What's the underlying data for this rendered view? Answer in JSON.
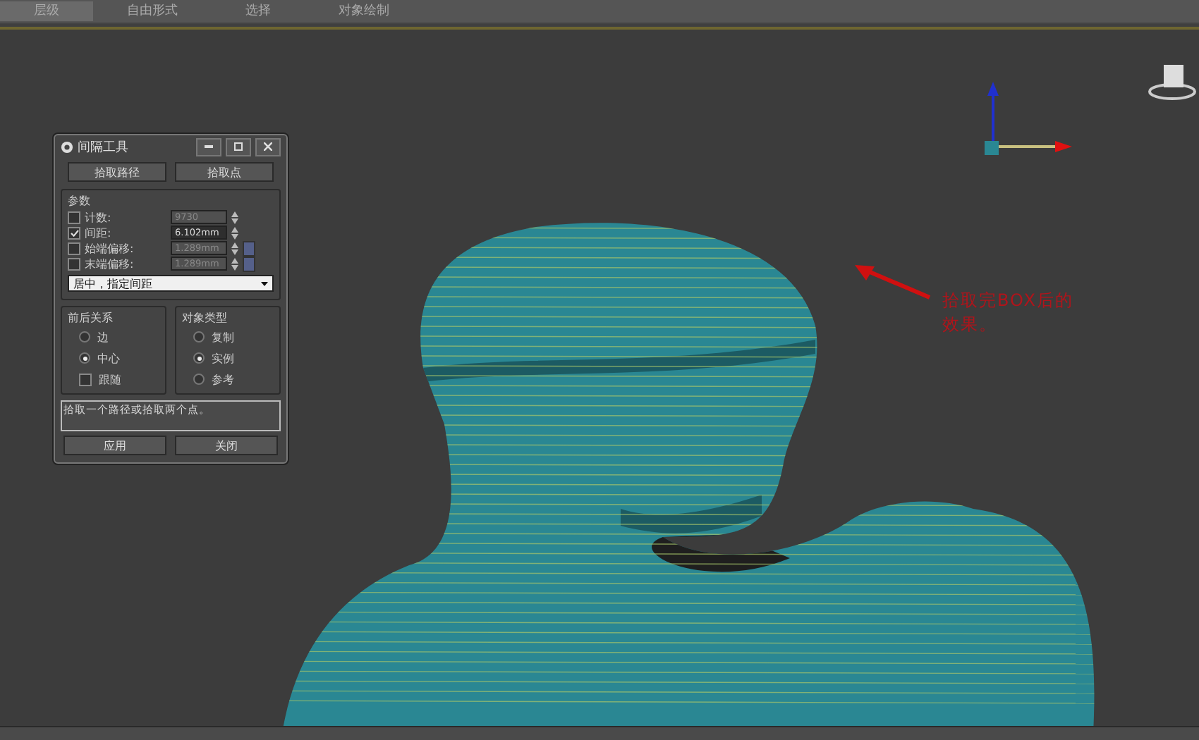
{
  "ribbon_tabs": [
    {
      "label": "层级",
      "selected": true
    },
    {
      "label": "自由形式",
      "selected": false
    },
    {
      "label": "选择",
      "selected": false
    },
    {
      "label": "对象绘制",
      "selected": false
    }
  ],
  "dialog": {
    "title": "间隔工具",
    "pick_buttons": [
      "拾取路径",
      "拾取点"
    ],
    "params_title": "参数",
    "params": [
      {
        "label": "计数:",
        "value": "9730",
        "checked": false,
        "disabled": true,
        "kind": "spinner"
      },
      {
        "label": "间距:",
        "value": "6.102mm",
        "checked": true,
        "disabled": false,
        "kind": "spinner"
      },
      {
        "label": "始端偏移:",
        "value": "1.289mm",
        "checked": false,
        "disabled": true,
        "kind": "lock"
      },
      {
        "label": "末端偏移:",
        "value": "1.289mm",
        "checked": false,
        "disabled": true,
        "kind": "lock"
      }
    ],
    "distribution": "居中，指定间距",
    "context": {
      "title": "前后关系",
      "options": [
        {
          "label": "边",
          "selected": false
        },
        {
          "label": "中心",
          "selected": true
        }
      ],
      "follow": {
        "label": "跟随",
        "checked": false
      }
    },
    "object_type": {
      "title": "对象类型",
      "options": [
        {
          "label": "复制",
          "selected": false
        },
        {
          "label": "实例",
          "selected": true
        },
        {
          "label": "参考",
          "selected": false
        }
      ]
    },
    "status": "拾取一个路径或拾取两个点。",
    "buttons": [
      "应用",
      "关闭"
    ]
  },
  "annotation": {
    "text": "拾取完BOX后的效果。"
  }
}
